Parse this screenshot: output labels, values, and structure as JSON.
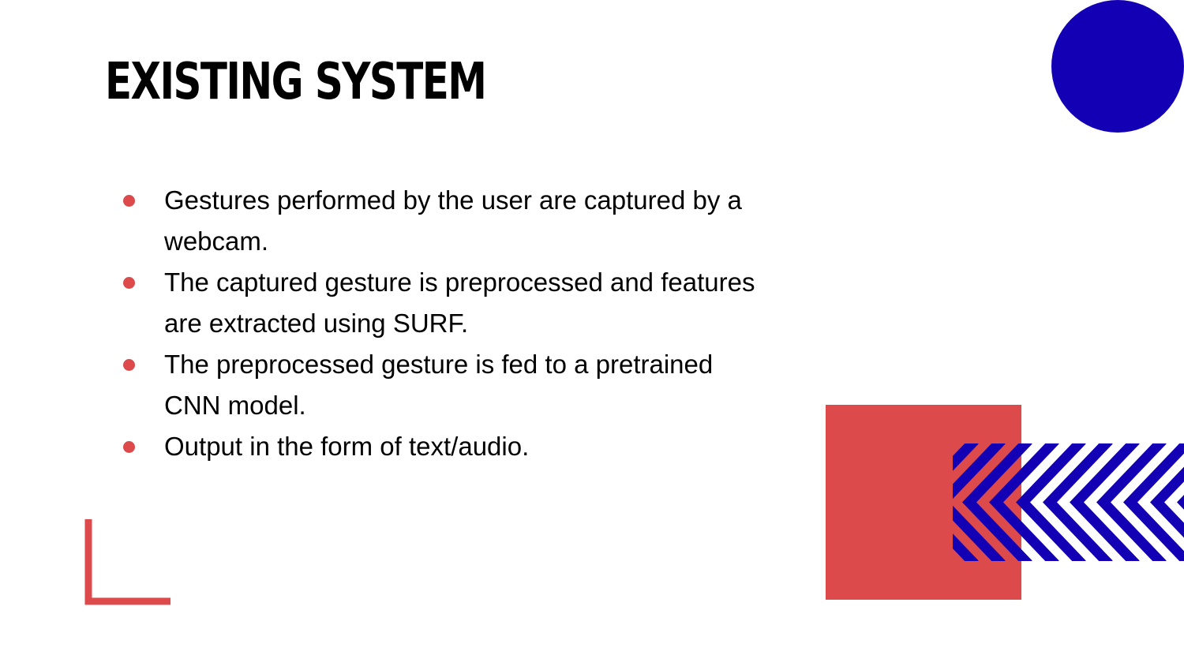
{
  "slide": {
    "title": "EXISTING SYSTEM",
    "bullets": [
      "Gestures performed by the user are captured by a webcam.",
      "The captured gesture is preprocessed and features are extracted using SURF.",
      "The preprocessed gesture is fed to a pretrained CNN model.",
      "Output in the form of text/audio."
    ]
  },
  "colors": {
    "accent_red": "#dc4a4c",
    "accent_blue": "#1400b4",
    "text": "#000000",
    "background": "#ffffff"
  },
  "decorations": [
    "blue-circle",
    "red-square",
    "blue-chevron-pattern",
    "red-corner-bracket"
  ]
}
